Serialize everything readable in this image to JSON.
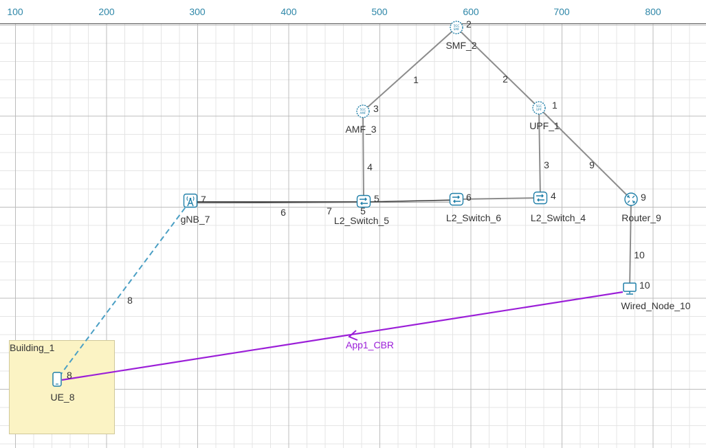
{
  "ruler": {
    "ticks": [
      "100",
      "200",
      "300",
      "400",
      "500",
      "600",
      "700",
      "800"
    ]
  },
  "building": {
    "label": "Building_1"
  },
  "nodes": [
    {
      "id": "1",
      "name": "UPF_1",
      "type": "upf",
      "icon_text": "5GC UPF"
    },
    {
      "id": "2",
      "name": "SMF_2",
      "type": "smf",
      "icon_text": "5GC SMF"
    },
    {
      "id": "3",
      "name": "AMF_3",
      "type": "amf",
      "icon_text": "5GC AMF"
    },
    {
      "id": "4",
      "name": "L2_Switch_4",
      "type": "switch"
    },
    {
      "id": "5",
      "name": "L2_Switch_5",
      "type": "switch"
    },
    {
      "id": "6",
      "name": "L2_Switch_6",
      "type": "switch"
    },
    {
      "id": "7",
      "name": "gNB_7",
      "type": "gnb"
    },
    {
      "id": "8",
      "name": "UE_8",
      "type": "ue"
    },
    {
      "id": "9",
      "name": "Router_9",
      "type": "router"
    },
    {
      "id": "10",
      "name": "Wired_Node_10",
      "type": "wired"
    }
  ],
  "links": [
    {
      "id": "1",
      "from": "3",
      "to": "2",
      "style": "wired"
    },
    {
      "id": "2",
      "from": "2",
      "to": "1",
      "style": "wired"
    },
    {
      "id": "3",
      "from": "1",
      "to": "4",
      "style": "wired"
    },
    {
      "id": "4",
      "from": "3",
      "to": "5",
      "style": "wired"
    },
    {
      "id": "5",
      "from": "5",
      "to": "6",
      "style": "wired"
    },
    {
      "id": "6",
      "from": "7",
      "to": "5",
      "style": "wired"
    },
    {
      "id": "7",
      "from": "6",
      "to": "4",
      "style": "wired"
    },
    {
      "id": "8",
      "from": "7",
      "to": "8",
      "style": "wireless"
    },
    {
      "id": "9",
      "from": "1",
      "to": "9",
      "style": "wired"
    },
    {
      "id": "10",
      "from": "9",
      "to": "10",
      "style": "wired"
    }
  ],
  "application": {
    "label": "App1_CBR",
    "from": "10",
    "to": "8"
  },
  "colors": {
    "wired_link": "#8c8c8c",
    "wired_link_dark": "#3a3a3a",
    "wireless_link": "#4a9fc4",
    "application": "#9b1ed8",
    "icon": "#1f7fa8",
    "building_fill": "#fbf3c4"
  }
}
